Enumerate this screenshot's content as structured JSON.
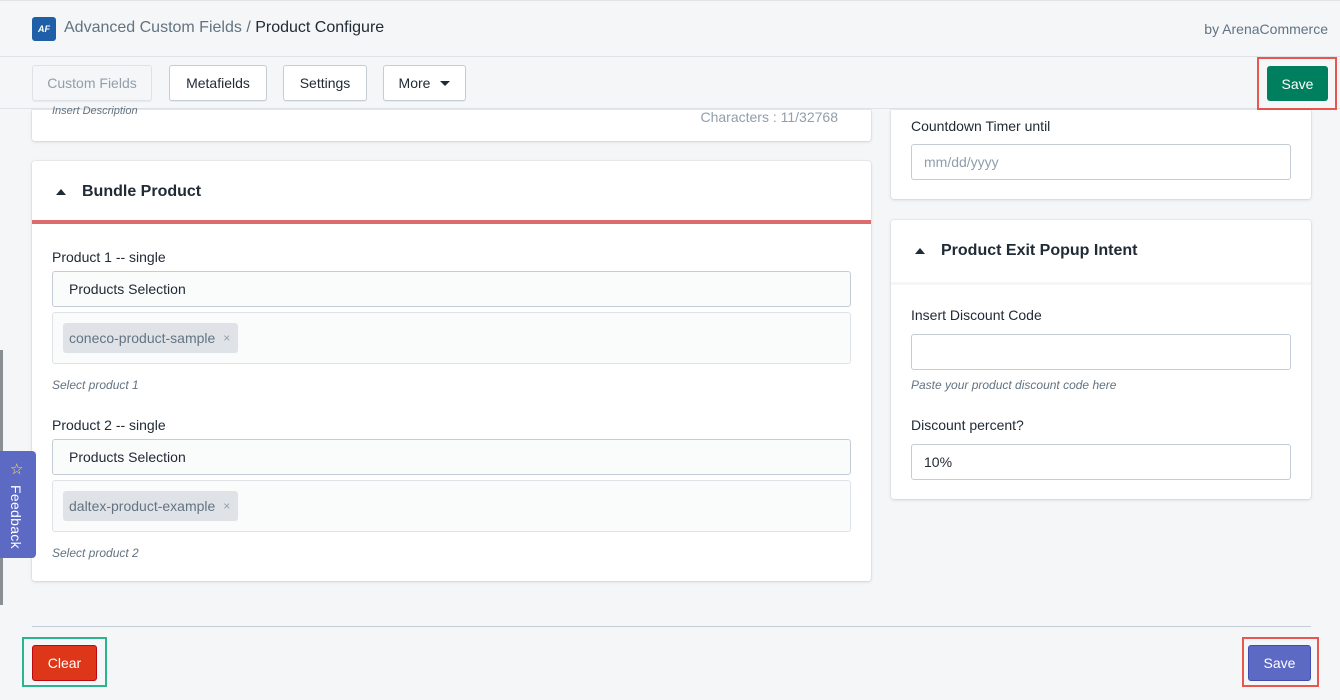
{
  "header": {
    "app_name": "Advanced Custom Fields",
    "separator": "/",
    "page_name": "Product Configure",
    "byline": "by ArenaCommerce",
    "logo_text": "AF"
  },
  "toolbar": {
    "custom_fields": "Custom Fields",
    "metafields": "Metafields",
    "settings": "Settings",
    "more": "More",
    "save": "Save"
  },
  "description_card": {
    "hint": "Insert Description",
    "char_count": "Characters : 11/32768"
  },
  "bundle": {
    "title": "Bundle Product",
    "accent_color": "#de6b6b",
    "products": [
      {
        "label": "Product 1 -- single",
        "selector": "Products Selection",
        "tag": "coneco-product-sample",
        "remove": "×",
        "hint": "Select product 1"
      },
      {
        "label": "Product 2 -- single",
        "selector": "Products Selection",
        "tag": "daltex-product-example",
        "remove": "×",
        "hint": "Select product 2"
      }
    ]
  },
  "countdown": {
    "label": "Countdown Timer until",
    "placeholder": "mm/dd/yyyy"
  },
  "exit_popup": {
    "title": "Product Exit Popup Intent",
    "discount_code_label": "Insert Discount Code",
    "discount_code_value": "",
    "discount_code_hint": "Paste your product discount code here",
    "discount_percent_label": "Discount percent?",
    "discount_percent_value": "10%"
  },
  "feedback": {
    "label": "Feedback",
    "icon": "star-icon"
  },
  "footer": {
    "clear": "Clear",
    "save": "Save"
  },
  "colors": {
    "save_primary": "#007f5f",
    "save_secondary": "#5c6ac4",
    "clear": "#de3618",
    "highlight_red": "#e8574f",
    "highlight_green": "#2bb58d"
  }
}
